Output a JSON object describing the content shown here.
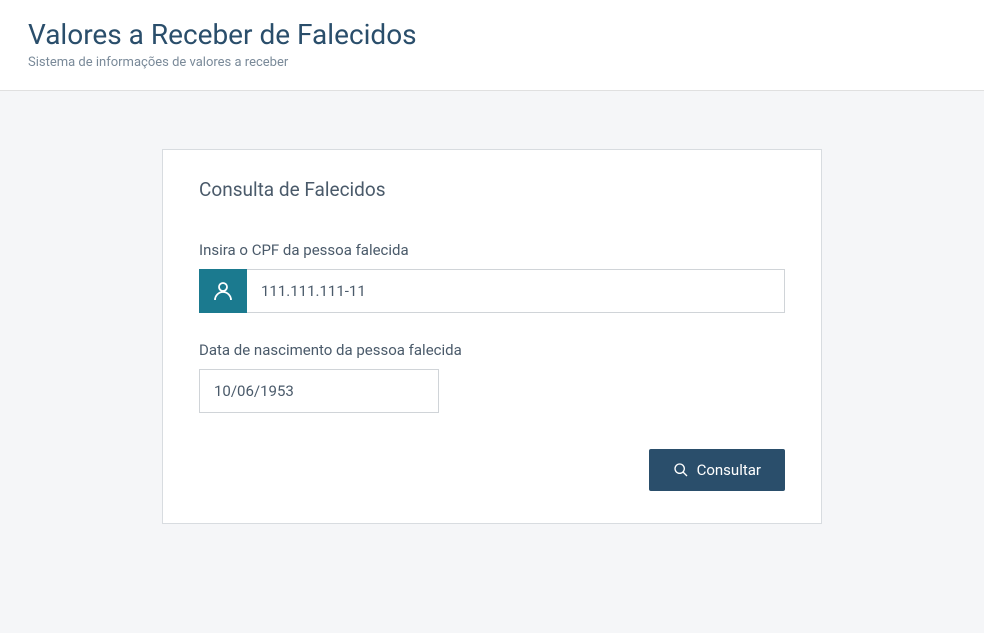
{
  "header": {
    "title": "Valores a Receber de Falecidos",
    "subtitle": "Sistema de informações de valores a receber"
  },
  "card": {
    "title": "Consulta de Falecidos",
    "form": {
      "cpf": {
        "label": "Insira o CPF da pessoa falecida",
        "value": "111.111.111-11"
      },
      "birthdate": {
        "label": "Data de nascimento da pessoa falecida",
        "value": "10/06/1953"
      },
      "submit": {
        "label": "Consultar"
      }
    }
  },
  "colors": {
    "header_text": "#2a4e6b",
    "accent_teal": "#1b7a8f",
    "button_bg": "#2a4e6b"
  }
}
